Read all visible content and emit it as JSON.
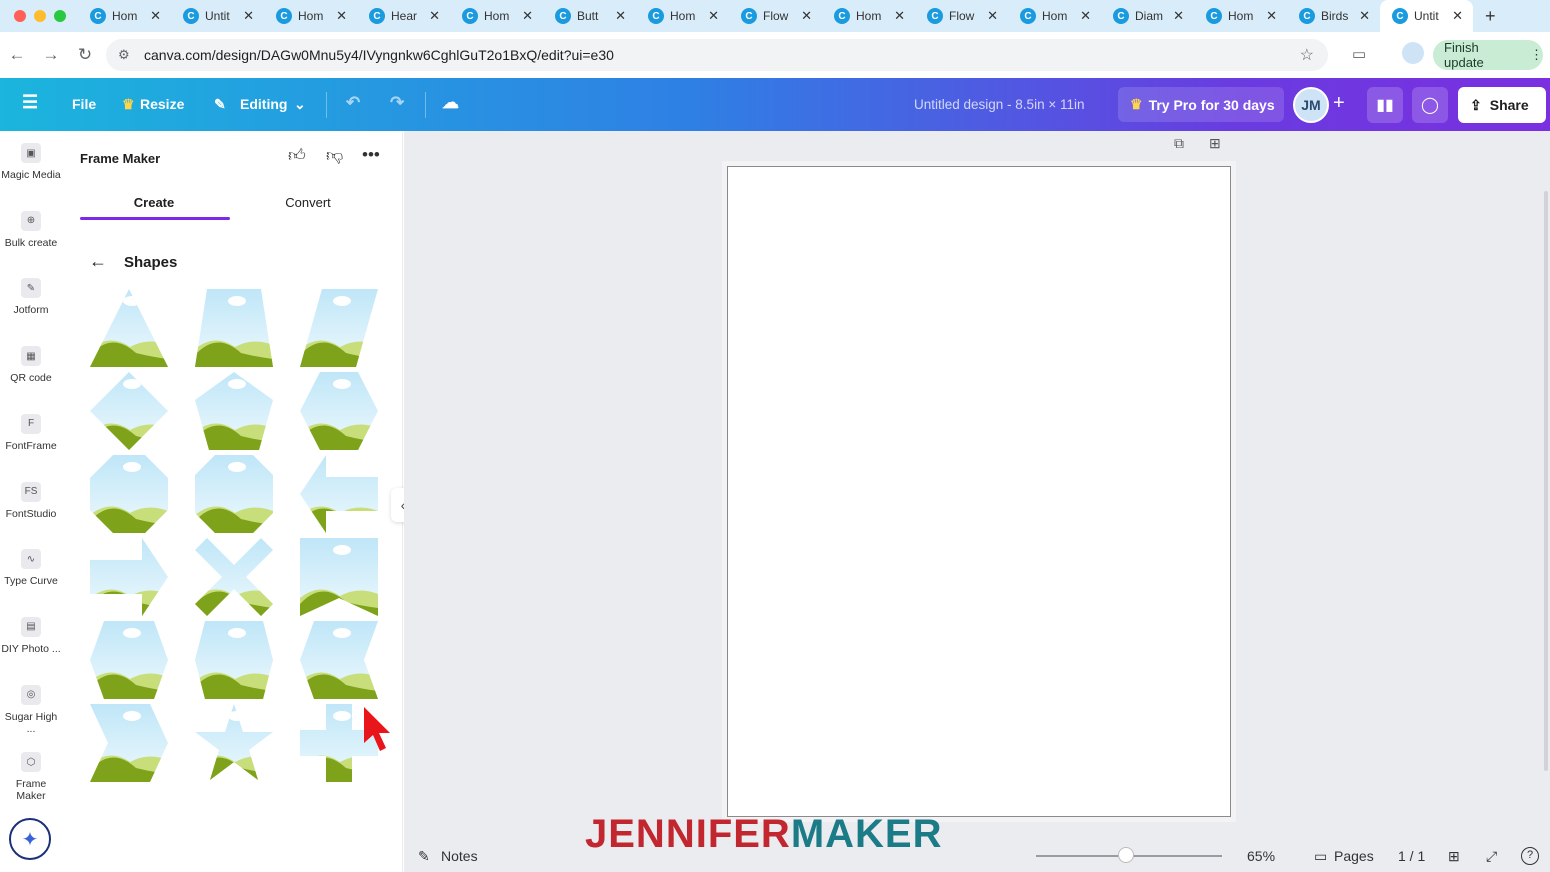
{
  "browser": {
    "tabs": [
      {
        "label": "Hom",
        "active": false
      },
      {
        "label": "Untit",
        "active": false
      },
      {
        "label": "Hom",
        "active": false
      },
      {
        "label": "Hear",
        "active": false
      },
      {
        "label": "Hom",
        "active": false
      },
      {
        "label": "Butt",
        "active": false
      },
      {
        "label": "Hom",
        "active": false
      },
      {
        "label": "Flow",
        "active": false
      },
      {
        "label": "Hom",
        "active": false
      },
      {
        "label": "Flow",
        "active": false
      },
      {
        "label": "Hom",
        "active": false
      },
      {
        "label": "Diam",
        "active": false
      },
      {
        "label": "Hom",
        "active": false
      },
      {
        "label": "Birds",
        "active": false
      },
      {
        "label": "Untit",
        "active": true
      }
    ],
    "url": "canva.com/design/DAGw0Mnu5y4/IVyngnkw6CghlGuT2o1BxQ/edit?ui=e30",
    "finish_update": "Finish update"
  },
  "header": {
    "file": "File",
    "resize": "Resize",
    "editing": "Editing",
    "doc_title": "Untitled design - 8.5in × 11in",
    "try_pro": "Try Pro for 30 days",
    "share": "Share"
  },
  "rail": {
    "items": [
      {
        "label": "Magic Media"
      },
      {
        "label": "Bulk create"
      },
      {
        "label": "Jotform"
      },
      {
        "label": "QR code"
      },
      {
        "label": "FontFrame"
      },
      {
        "label": "FontStudio"
      },
      {
        "label": "Type Curve"
      },
      {
        "label": "DIY Photo ..."
      },
      {
        "label": "Sugar High ..."
      },
      {
        "label": "Frame Maker"
      }
    ]
  },
  "panel": {
    "title": "Frame Maker",
    "tabs": [
      "Create",
      "Convert"
    ],
    "section": "Shapes",
    "shapes": [
      "triangle",
      "trapezoid",
      "parallelogram",
      "diamond",
      "pentagon",
      "hexagon",
      "octagon",
      "rounded-octagon",
      "arrow-left",
      "arrow-right",
      "cross",
      "banner",
      "hexagon-wide",
      "chevron-hexagon",
      "left-chevron",
      "chevron",
      "star",
      "plus"
    ]
  },
  "footer": {
    "notes": "Notes",
    "zoom": "65%",
    "pages": "Pages",
    "page_count": "1 / 1"
  },
  "watermark": {
    "part1": "JENNIFER",
    "part2": "MAKER"
  },
  "colors": {
    "accent": "#7d2ae8",
    "grass": "#7ea21a",
    "sky": "#d8f0fb"
  }
}
